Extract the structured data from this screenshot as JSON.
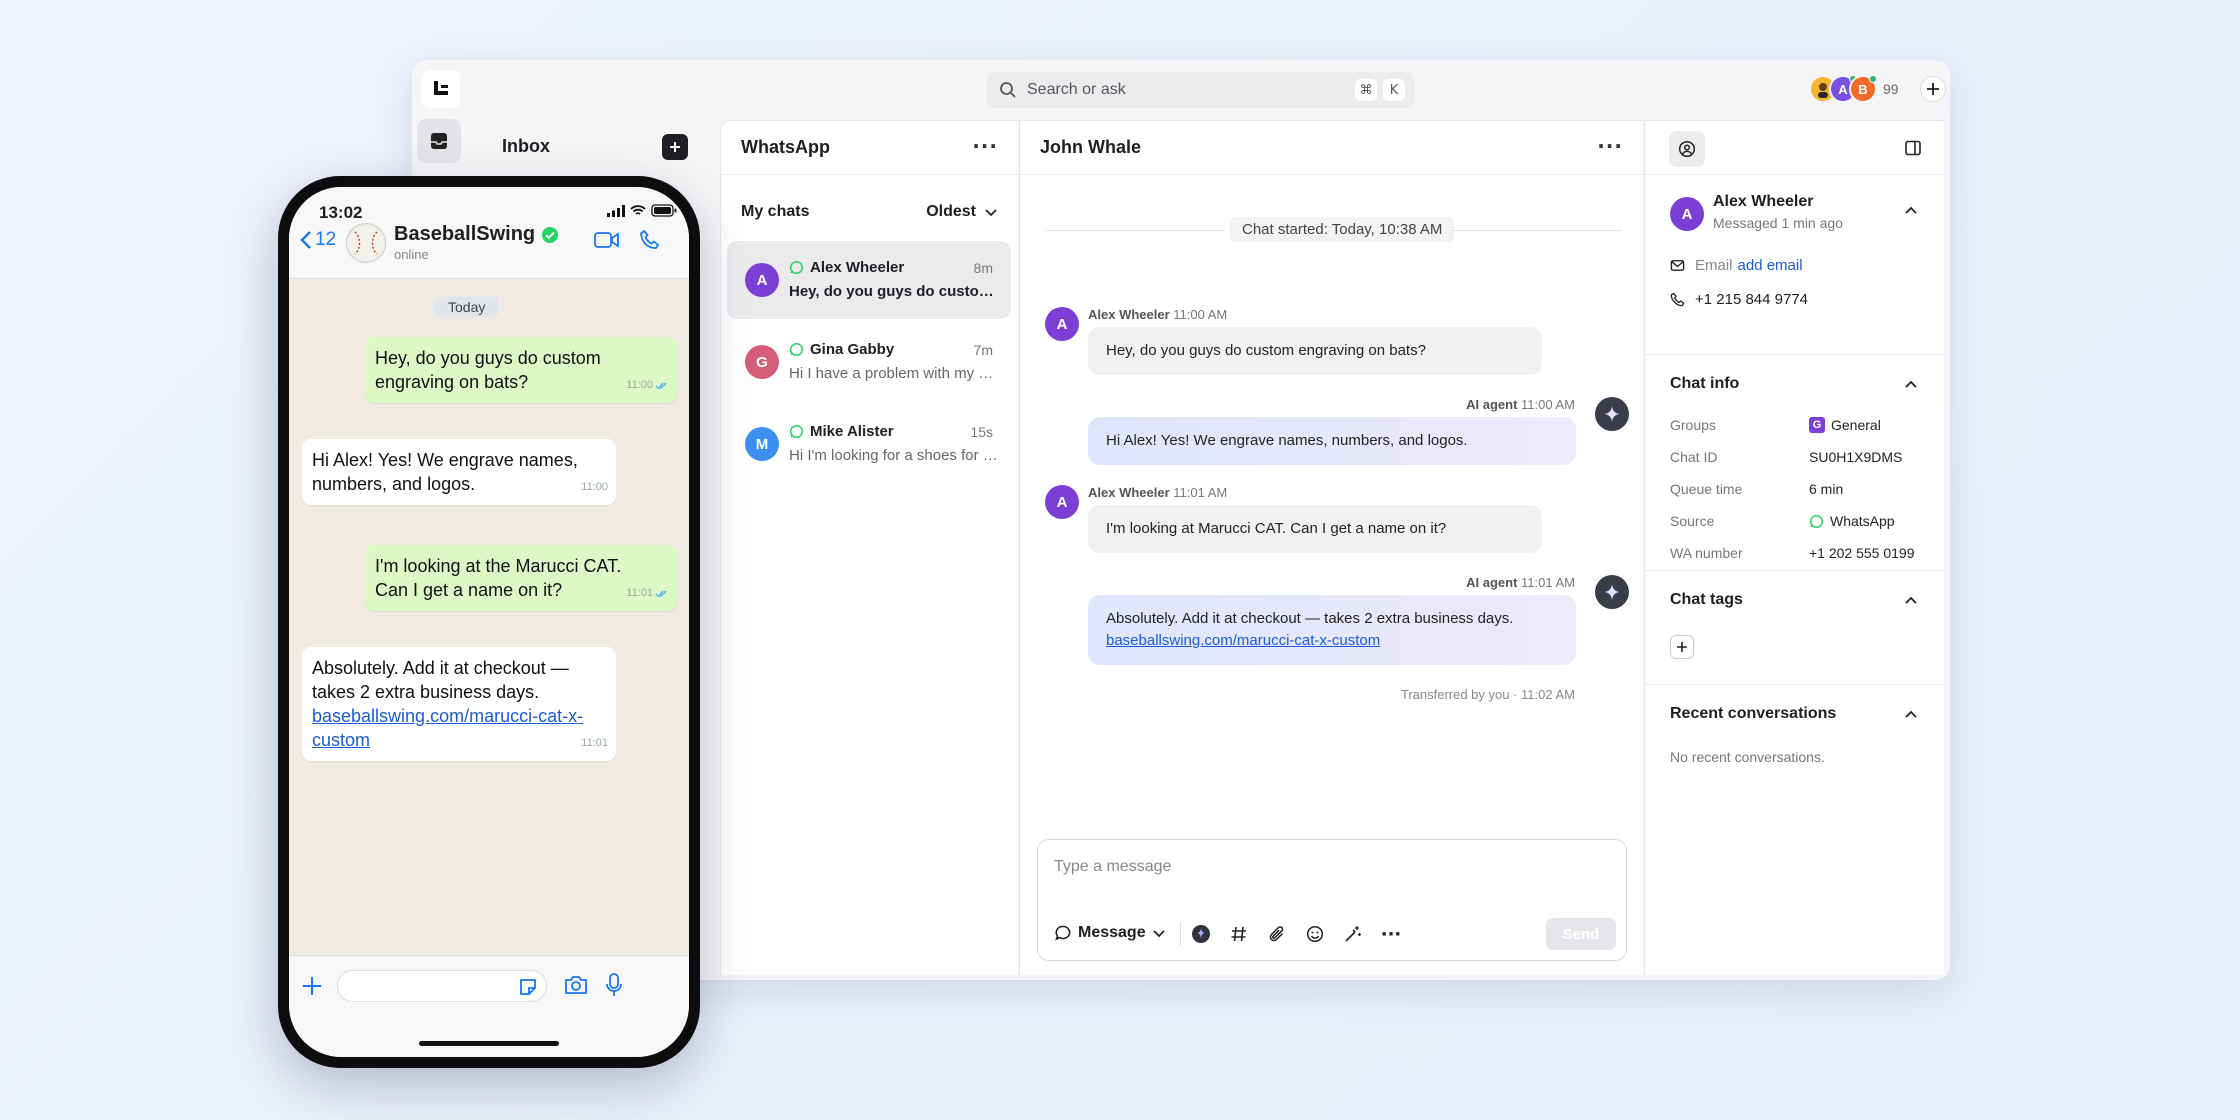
{
  "search": {
    "placeholder": "Search or ask",
    "key1": "⌘",
    "key2": "K"
  },
  "presence": {
    "count": "99",
    "avatars": [
      {
        "letter": "A",
        "color": "#7b4de0",
        "dot": "#2bb673"
      },
      {
        "letter": "B",
        "color": "#f36b2b",
        "dot": "#2bb673"
      }
    ]
  },
  "sidebar": {
    "title": "Inbox"
  },
  "list": {
    "title": "WhatsApp",
    "section": "My chats",
    "sort": "Oldest",
    "chats": [
      {
        "avatar": "A",
        "color": "#7b3fd6",
        "name": "Alex Wheeler",
        "time": "8m",
        "preview": "Hey, do you guys do custom engraving on bats?"
      },
      {
        "avatar": "G",
        "color": "#d45d78",
        "name": "Gina Gabby",
        "time": "7m",
        "preview": "Hi I have a problem with my order"
      },
      {
        "avatar": "M",
        "color": "#3b8ff0",
        "name": "Mike Alister",
        "time": "15s",
        "preview": "Hi I'm looking for a shoes for kids"
      }
    ]
  },
  "chat": {
    "title": "John Whale",
    "started": "Chat started: Today, 10:38 AM",
    "messages": [
      {
        "sender": "Alex Wheeler",
        "time": "11:00 AM",
        "avatar": "A",
        "text": "Hey, do you guys do custom engraving on bats?"
      },
      {
        "sender": "AI agent",
        "time": "11:00 AM",
        "text": "Hi Alex! Yes! We engrave names, numbers, and logos."
      },
      {
        "sender": "Alex Wheeler",
        "time": "11:01 AM",
        "avatar": "A",
        "text": "I'm looking at Marucci CAT. Can I get a name on it?"
      },
      {
        "sender": "AI agent",
        "time": "11:01 AM",
        "text": "Absolutely. Add it at checkout — takes 2 extra business days.",
        "link": "baseballswing.com/marucci-cat-x-custom"
      }
    ],
    "transferred": "Transferred by you · 11:02 AM",
    "composer": {
      "placeholder": "Type a message",
      "mode": "Message",
      "send": "Send"
    }
  },
  "info": {
    "contact": {
      "avatar": "A",
      "name": "Alex Wheeler",
      "status": "Messaged 1 min ago",
      "email_label": "Email",
      "email_action": "add email",
      "phone": "+1 215 844 9774"
    },
    "chat_info": {
      "title": "Chat info",
      "rows": [
        {
          "label": "Groups",
          "value": "General",
          "badge": "G"
        },
        {
          "label": "Chat ID",
          "value": "SU0H1X9DMS"
        },
        {
          "label": "Queue time",
          "value": "6 min"
        },
        {
          "label": "Source",
          "value": "WhatsApp"
        },
        {
          "label": "WA number",
          "value": "+1 202 555 0199"
        }
      ]
    },
    "tags": {
      "title": "Chat tags"
    },
    "recent": {
      "title": "Recent conversations",
      "empty": "No recent conversations."
    }
  },
  "phone": {
    "time": "13:02",
    "back_count": "12",
    "name": "BaseballSwing",
    "status": "online",
    "day": "Today",
    "messages": [
      {
        "text": "Hey, do you guys do custom engraving on bats?",
        "time": "11:00",
        "side": "out"
      },
      {
        "text": "Hi Alex! Yes! We engrave names, numbers, and logos.",
        "time": "11:00",
        "side": "in"
      },
      {
        "text": "I'm looking at the Marucci CAT. Can I get a name on it?",
        "time": "11:01",
        "side": "out"
      },
      {
        "text": "Absolutely. Add it at checkout — takes 2 extra business days.",
        "link": "baseballswing.com/marucci-cat-x-custom",
        "time": "11:01",
        "side": "in"
      }
    ]
  }
}
